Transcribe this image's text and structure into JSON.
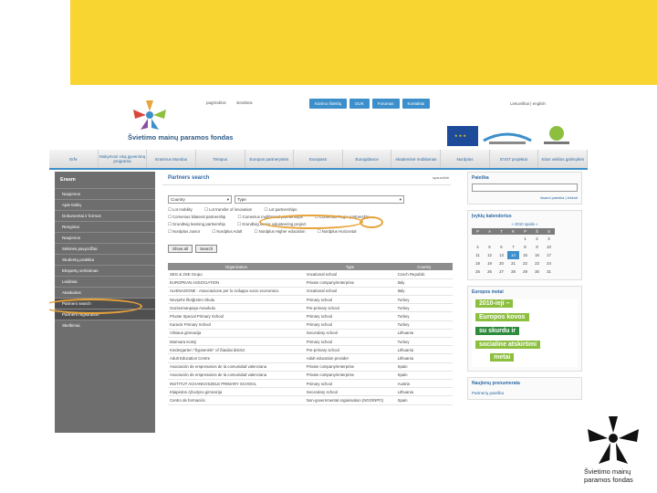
{
  "colors": {
    "accent_yellow": "#f9d532",
    "nav_blue": "#3c8fca",
    "sidebar_gray": "#6e6e6e",
    "highlight_orange": "#e8a33a"
  },
  "header": {
    "org_name": "Švietimo mainų paramos fondas",
    "top_links": [
      "pagrindinis",
      "struktūra"
    ],
    "nav_buttons": [
      "Kūrimo išteklių",
      "DUK",
      "Forumas",
      "Kontaktai"
    ],
    "lang_links": "Lietuviškai | english"
  },
  "tabs": [
    "Erfe",
    "Mokymosi visą gyvenimą programa",
    "Erasmus Mundus",
    "Tempus",
    "Europos partnerystės",
    "Europass",
    "Eurogidance",
    "Akademinė mobilumas",
    "Nordplus",
    "EVST projektai",
    "Kitos veiklos galimybės"
  ],
  "sidebar": {
    "title": "Erasm",
    "items": [
      "Naujienos",
      "Apie tinklą",
      "Dokumentai ir formos",
      "Renginiai",
      "Naujienos",
      "Sėkmės pavyzdžiai",
      "Studentų praktika",
      "Ekspertų vertinimas",
      "Leidiniai",
      "Ataskaitos",
      "Partners search",
      "Partners registration",
      "Skelbimai"
    ]
  },
  "main": {
    "title": "Partners search",
    "print_label": "spausdinti",
    "select_country": "Country",
    "select_type": "Type",
    "checkbox_rows": [
      [
        "Lot mobility",
        "Lot transfer of innovation",
        "Lot partnerships"
      ],
      [
        "Comenius bilateral partnership",
        "Comenius multilateral partnerships",
        "Comenius Regio partnership"
      ],
      [
        "Grundtvig learning partnership",
        "Grundtvig senior volunteering project"
      ],
      [
        "Nordplus Junior",
        "Nordplus Adult",
        "Nordplus Higher education",
        "Nordplus Horizontal"
      ]
    ],
    "buttons": [
      "Show all",
      "Search"
    ],
    "table_headers": [
      "Organization",
      "Type",
      "Country"
    ],
    "rows": [
      [
        "SEG & 2SE Grupo",
        "Vocational school",
        "Czech Republic"
      ],
      [
        "EUROPEAN ASSOCIATION",
        "Private company/enterprise",
        "Italy"
      ],
      [
        "ALIENAZIONE - Associazione per lo sviluppo socio economico",
        "Vocational school",
        "Italy"
      ],
      [
        "Nevşehir İlköğretim Okulu",
        "Primary school",
        "Turkey"
      ],
      [
        "Gaziosmanpaşa Anaokulu",
        "Pre-primary school",
        "Turkey"
      ],
      [
        "Private Special Primary School",
        "Primary school",
        "Turkey"
      ],
      [
        "Karacık Primary School",
        "Primary school",
        "Turkey"
      ],
      [
        "Vilniaus gimnazija",
        "Secondary school",
        "Lithuania"
      ],
      [
        "Marmara Koleji",
        "Primary school",
        "Turkey"
      ],
      [
        "Kindergarten \"Šypsenėlė\" of Šiauliai district",
        "Pre-primary school",
        "Lithuania"
      ],
      [
        "Adult Education Centre",
        "Adult education provider",
        "Lithuania"
      ],
      [
        "Asociación de empresarios de la comunidad valenciana",
        "Private company/enterprise",
        "Spain"
      ],
      [
        "Asociación de empresarios de la comunidad valenciana",
        "Private company/enterprise",
        "Spain"
      ],
      [
        "INSTITUT ACHANKOSZELE PRIMARY SCHOOL",
        "Primary school",
        "Austria"
      ],
      [
        "Klaipėdos Ąžuolyno gimnazija",
        "Secondary school",
        "Lithuania"
      ],
      [
        "Centro de formación",
        "Non-governmental organisation (NGO/NPO)",
        "Spain"
      ]
    ]
  },
  "right": {
    "search_title": "Paieška",
    "search_links": "išsami paieška | ieškoti",
    "calendar_title": "Įvykių kalendorius",
    "calendar_month": "« 2010 spalis »",
    "weekdays": [
      "P",
      "A",
      "T",
      "K",
      "P",
      "Š",
      "S"
    ],
    "weeks": [
      [
        "",
        "",
        "",
        "",
        "1",
        "2",
        "3"
      ],
      [
        "4",
        "5",
        "6",
        "7",
        "8",
        "9",
        "10"
      ],
      [
        "11",
        "12",
        "13",
        "14",
        "15",
        "16",
        "17"
      ],
      [
        "18",
        "19",
        "20",
        "21",
        "22",
        "23",
        "24"
      ],
      [
        "25",
        "26",
        "27",
        "28",
        "29",
        "30",
        "31"
      ]
    ],
    "banner_title": "Europos metai",
    "banner_lines": [
      "2010-ieji –",
      "Europos kovos",
      "su skurdu ir",
      "socialine atskirtimi",
      "metai"
    ],
    "newsletter_title": "Naujienų prenumerata",
    "newsletter_link": "Partnerių paieška"
  },
  "footer_logo_text": [
    "Švietimo mainų",
    "paramos fondas"
  ]
}
